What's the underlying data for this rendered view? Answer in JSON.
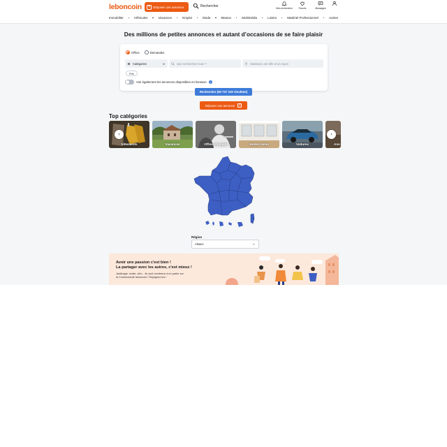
{
  "header": {
    "logo": "leboncoin",
    "post_ad_label": "Déposer une annonce",
    "search_label": "Rechercher",
    "icons": [
      {
        "icon": "bell-icon",
        "label": "Mes recherches"
      },
      {
        "icon": "heart-icon",
        "label": "Favoris"
      },
      {
        "icon": "message-icon",
        "label": "Messages"
      },
      {
        "icon": "user-icon",
        "label": ""
      }
    ]
  },
  "nav": {
    "categories": [
      "Immobilier",
      "Véhicules",
      "Vacances",
      "Emploi",
      "Mode",
      "Maison",
      "Multimédia",
      "Loisirs",
      "Matériel Professionnel",
      "Autres"
    ]
  },
  "headline": "Des millions de petites annonces et autant d’occasions de se faire plaisir",
  "search": {
    "radio_offers": "Offres",
    "radio_requests": "Demandes",
    "selected": "Offres",
    "category_value": "Catégories",
    "query_placeholder": "Que recherchez-vous ?",
    "location_placeholder": "Saisissez une ville et un rayon",
    "price_chip": "Prix",
    "delivery_label": "Voir également les annonces disponibles en livraison",
    "delivery_enabled": false,
    "submit_label": "Rechercher (60 737 319 résultats)"
  },
  "post_ad_button": "Déposer une annonce",
  "top_categories": {
    "title": "Top catégories",
    "items": [
      "Vêtements",
      "Vacances",
      "Offres d'emploi",
      "Ventes immo",
      "Voitures",
      "Ann"
    ]
  },
  "region": {
    "label": "Région",
    "value": "Alsace"
  },
  "promo": {
    "title_line1": "Avoir une passion c'est bien !",
    "title_line2": "La partager avec les autres, c'est mieux !",
    "body_line1": "Jardinage, mode, vélo... ils sont nombreux à en parler sur",
    "body_line2": "la Communauté leboncoin ! Rejoignez-les !"
  },
  "colors": {
    "brand": "#ec5a13",
    "primary": "#3e7bd9",
    "map_fill": "#3d5fc4",
    "background": "#f4f6f7"
  }
}
